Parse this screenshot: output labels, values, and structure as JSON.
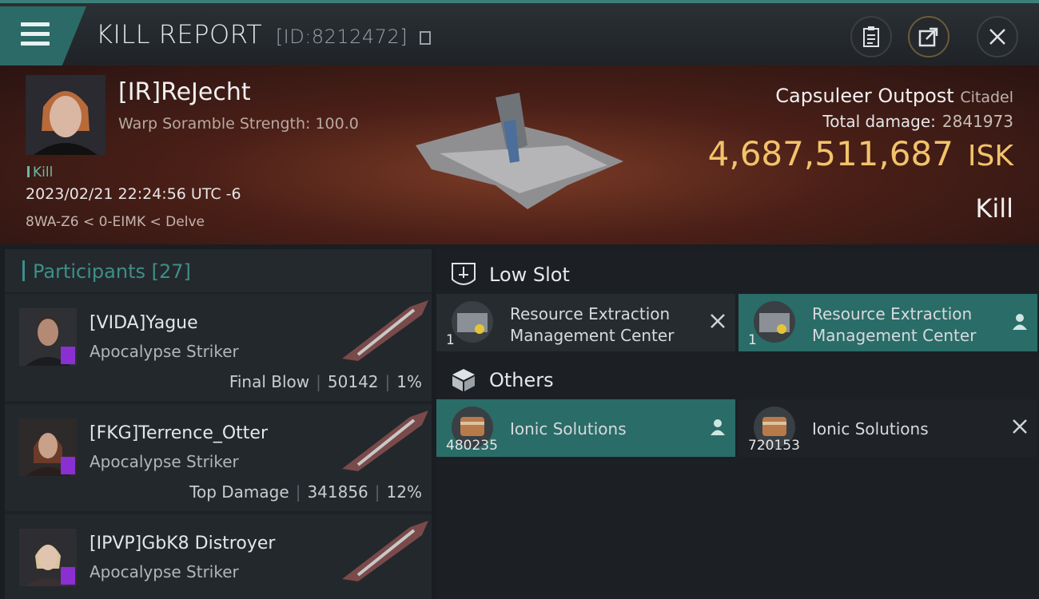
{
  "header": {
    "title": "KILL REPORT",
    "id_label": "[ID:8212472]"
  },
  "victim": {
    "name": "[IR]ReJecht",
    "scramble": "Warp Soramble Strength: 100.0",
    "tag": "Kill",
    "datetime": "2023/02/21 22:24:56 UTC -6",
    "location": "8WA-Z6 < 0-EIMK < Delve"
  },
  "target": {
    "name": "Capsuleer Outpost",
    "class": "Citadel",
    "damage_label": "Total damage:",
    "damage_value": "2841973",
    "isk_value": "4,687,511,687",
    "isk_unit": "ISK",
    "result": "Kill"
  },
  "participants": {
    "header": "Participants [27]",
    "rows": [
      {
        "name": "[VIDA]Yague",
        "ship": "Apocalypse Striker",
        "role": "Final Blow",
        "damage": "50142",
        "percent": "1%"
      },
      {
        "name": "[FKG]Terrence_Otter",
        "ship": "Apocalypse Striker",
        "role": "Top Damage",
        "damage": "341856",
        "percent": "12%"
      },
      {
        "name": "[IPVP]GbK8 Distroyer",
        "ship": "Apocalypse Striker",
        "role": "",
        "damage": "",
        "percent": ""
      }
    ]
  },
  "sections": {
    "low_slot": {
      "title": "Low Slot",
      "items": [
        {
          "name_line1": "Resource Extraction",
          "name_line2": "Management Center",
          "qty": "1",
          "state": "destroyed"
        },
        {
          "name_line1": "Resource Extraction",
          "name_line2": "Management Center",
          "qty": "1",
          "state": "dropped"
        }
      ]
    },
    "others": {
      "title": "Others",
      "items": [
        {
          "name": "Ionic Solutions",
          "qty": "480235",
          "state": "dropped"
        },
        {
          "name": "Ionic Solutions",
          "qty": "720153",
          "state": "destroyed"
        }
      ]
    }
  },
  "colors": {
    "accent_teal": "#2a6c67",
    "isk_gold": "#f2c36b",
    "corp_badge": "#8a2fd1"
  }
}
